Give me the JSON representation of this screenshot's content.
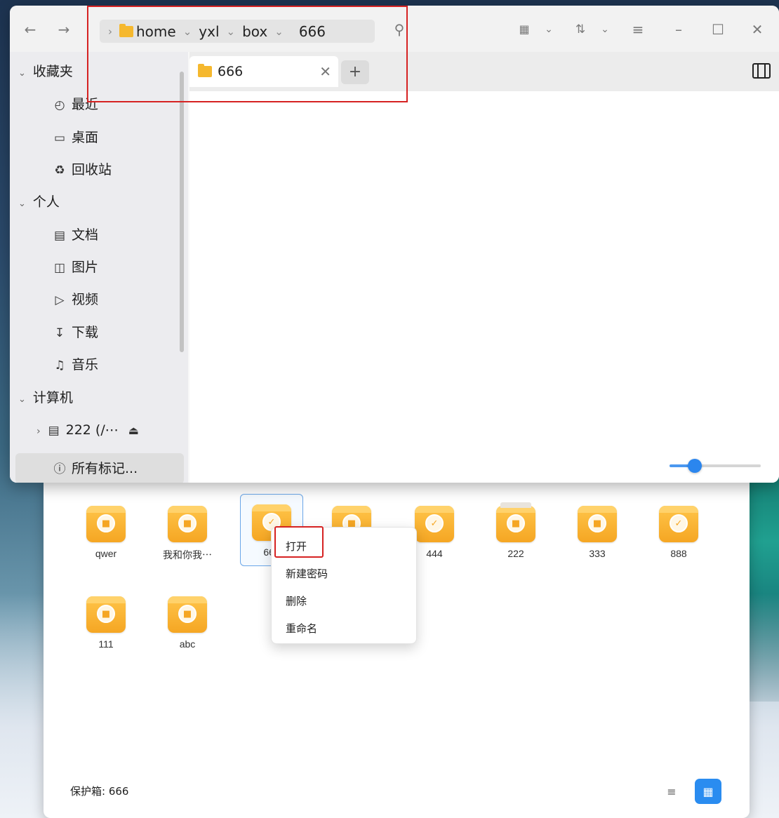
{
  "file_manager": {
    "breadcrumbs": [
      "home",
      "yxl",
      "box",
      "666"
    ],
    "tab": {
      "label": "666"
    },
    "sidebar": {
      "favorites_header": "收藏夹",
      "recent": "最近",
      "desktop": "桌面",
      "trash": "回收站",
      "personal_header": "个人",
      "documents": "文档",
      "pictures": "图片",
      "videos": "视频",
      "downloads": "下载",
      "music": "音乐",
      "computer_header": "计算机",
      "drive": "222 (/⋯",
      "all_tags": "所有标记..."
    },
    "zoom_fraction": 0.28
  },
  "vault": {
    "items": [
      {
        "label": "qwer",
        "state": "locked"
      },
      {
        "label": "我和你我⋯",
        "state": "locked"
      },
      {
        "label": "666",
        "state": "unlocked"
      },
      {
        "label": "",
        "state": "locked"
      },
      {
        "label": "444",
        "state": "unlocked"
      },
      {
        "label": "222",
        "state": "open"
      },
      {
        "label": "333",
        "state": "locked"
      },
      {
        "label": "888",
        "state": "unlocked"
      },
      {
        "label": "111",
        "state": "locked"
      },
      {
        "label": "abc",
        "state": "locked"
      }
    ],
    "status": "保护箱: 666"
  },
  "context_menu": {
    "items": [
      "打开",
      "新建密码",
      "删除",
      "重命名"
    ]
  },
  "colors": {
    "accent": "#2a8cf0",
    "vault_icon": "#f5a623",
    "highlight": "#d62222"
  }
}
